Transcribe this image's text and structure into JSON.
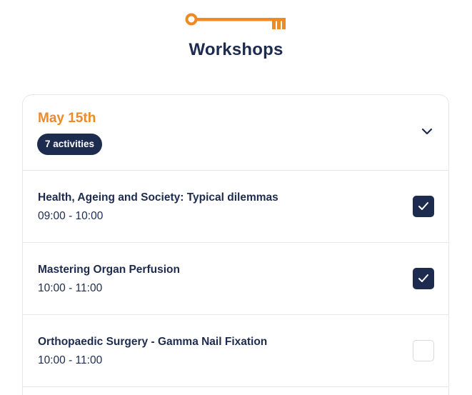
{
  "header": {
    "logo_icon": "key-icon",
    "title": "Workshops"
  },
  "colors": {
    "accent": "#ee8a25",
    "navy": "#1d2b4f",
    "border": "#e4e7ec"
  },
  "day": {
    "date": "May 15th",
    "activities_badge": "7 activities",
    "toggle_icon": "chevron-down-icon",
    "expanded": true
  },
  "workshops": [
    {
      "title": "Health, Ageing and Society: Typical dilemmas",
      "time": "09:00 - 10:00",
      "selected": true
    },
    {
      "title": "Mastering Organ Perfusion",
      "time": "10:00 - 11:00",
      "selected": true
    },
    {
      "title": "Orthopaedic Surgery - Gamma Nail Fixation",
      "time": "10:00 - 11:00",
      "selected": false
    }
  ]
}
